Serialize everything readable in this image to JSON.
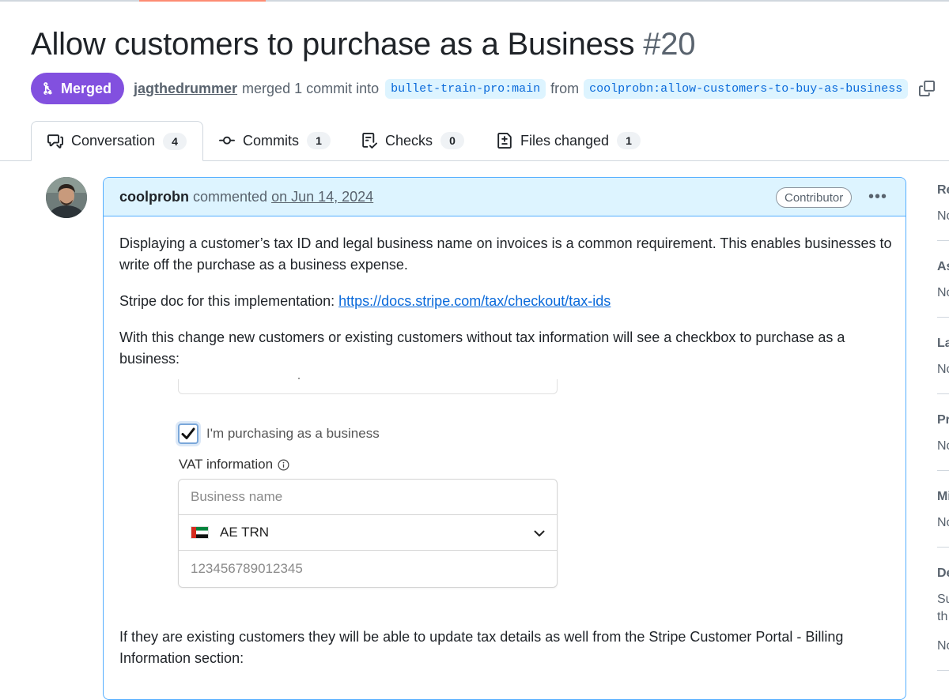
{
  "title": {
    "text": "Allow customers to purchase as a Business",
    "number": "#20"
  },
  "meta": {
    "state": "Merged",
    "author": "jagthedrummer",
    "action": "merged 1 commit into",
    "base_branch": "bullet-train-pro:main",
    "from_word": "from",
    "head_branch": "coolprobn:allow-customers-to-buy-as-business"
  },
  "tabs": [
    {
      "label": "Conversation",
      "count": "4",
      "icon": "comment-discussion-icon"
    },
    {
      "label": "Commits",
      "count": "1",
      "icon": "git-commit-icon"
    },
    {
      "label": "Checks",
      "count": "0",
      "icon": "checklist-icon"
    },
    {
      "label": "Files changed",
      "count": "1",
      "icon": "file-diff-icon"
    }
  ],
  "comment": {
    "author": "coolprobn",
    "verb": "commented",
    "date": "on Jun 14, 2024",
    "role": "Contributor",
    "p1": "Displaying a customer’s tax ID and legal business name on invoices is a common requirement. This enables businesses to write off the purchase as a business expense.",
    "p2_prefix": "Stripe doc for this implementation: ",
    "p2_link": "https://docs.stripe.com/tax/checkout/tax-ids",
    "p3": "With this change new customers or existing customers without tax information will see a checkbox to purchase as a business:",
    "p4": "If they are existing customers they will be able to update tax details as well from the Stripe Customer Portal - Billing Information section:"
  },
  "embedded_form": {
    "checkbox_label": "I'm purchasing as a business",
    "checkbox_checked": true,
    "vat_label": "VAT information",
    "business_name_placeholder": "Business name",
    "tax_type": "AE TRN",
    "tax_id_placeholder": "123456789012345"
  },
  "sidebar_partial": {
    "headers": [
      "Re",
      "As",
      "La",
      "Pr",
      "Mi",
      "De"
    ],
    "values": [
      "No",
      "No",
      "No",
      "No",
      "No",
      "Su",
      "th",
      "No"
    ]
  },
  "colors": {
    "merged": "#8250df",
    "link": "#0969da",
    "comment_header": "#ddf4ff",
    "comment_border": "#54aeff"
  }
}
